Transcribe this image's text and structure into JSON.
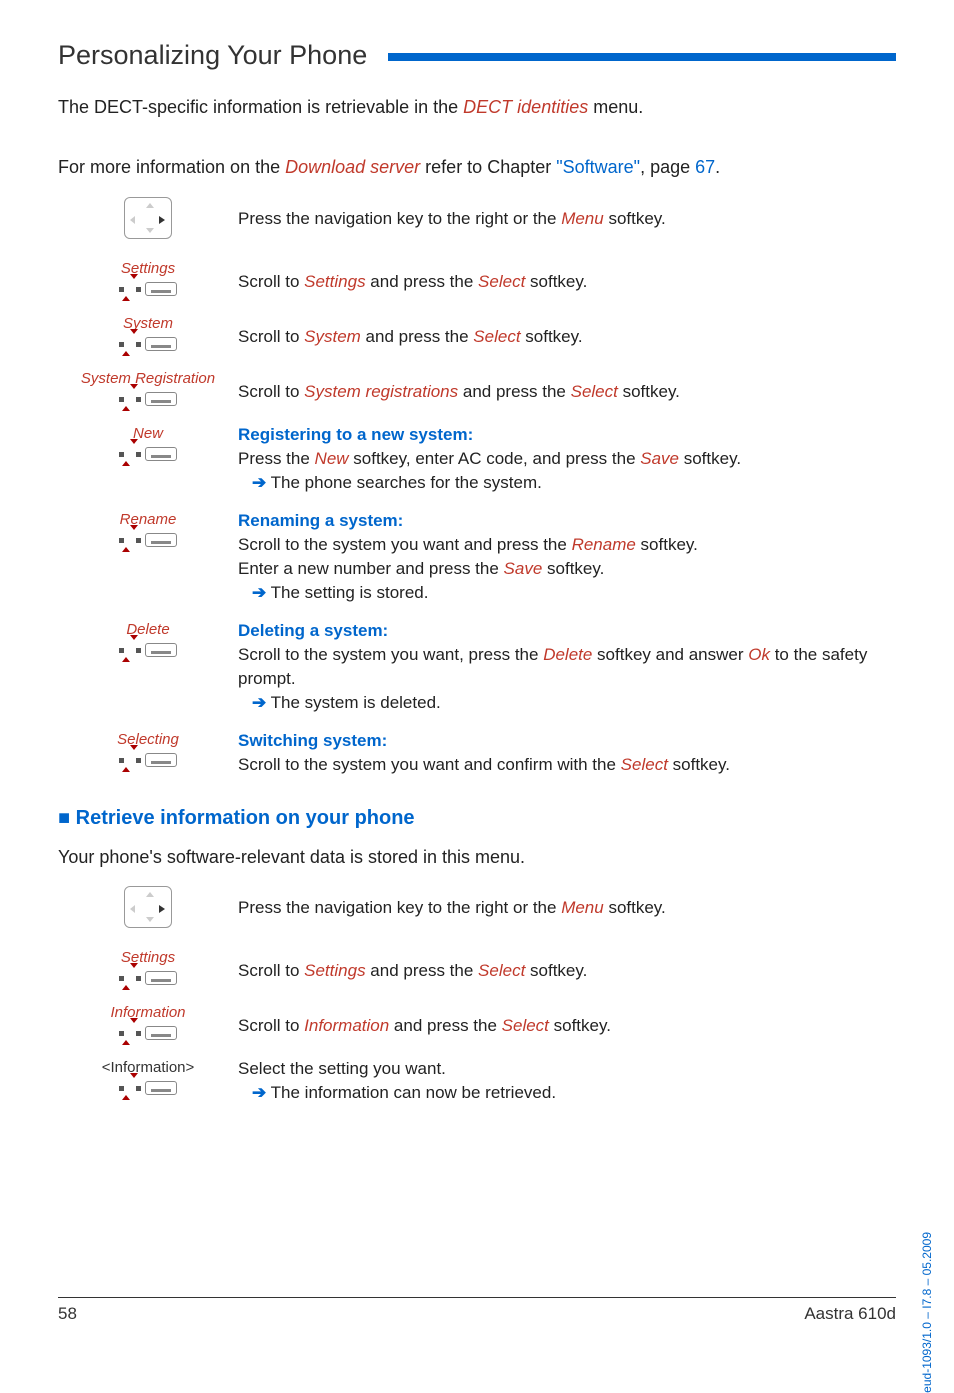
{
  "header": {
    "title": "Personalizing Your Phone"
  },
  "intro1": {
    "pre": "The DECT-specific information is retrievable in the ",
    "em": "DECT identities",
    "post": " menu."
  },
  "intro2": {
    "pre": "For more information on the ",
    "em": "Download server",
    "mid": " refer to Chapter ",
    "link1": "\"Software\"",
    "mid2": ", page ",
    "link2": "67",
    "post": "."
  },
  "steps1": {
    "navkey_text_pre": "Press the navigation key to the right or the ",
    "navkey_em": "Menu",
    "navkey_post": " softkey.",
    "settings_label": "Settings",
    "settings_pre": "Scroll to ",
    "settings_em1": "Settings",
    "settings_mid": " and press the ",
    "settings_em2": "Select",
    "settings_post": " softkey.",
    "system_label": "System",
    "system_pre": "Scroll to ",
    "system_em1": "System",
    "system_mid": " and press the ",
    "system_em2": "Select",
    "system_post": " softkey.",
    "sysreg_label": "System Registration",
    "sysreg_pre": "Scroll to ",
    "sysreg_em1": "System registrations",
    "sysreg_mid": " and press the ",
    "sysreg_em2": "Select",
    "sysreg_post": " softkey.",
    "new_label": "New",
    "new_heading": "Registering to a new system:",
    "new_line_pre": "Press the ",
    "new_em1": "New",
    "new_line_mid": " softkey, enter AC code, and press the ",
    "new_em2": "Save",
    "new_line_post": " softkey.",
    "new_result": " The phone searches for the system.",
    "rename_label": "Rename",
    "rename_heading": "Renaming a system:",
    "rename_line1_pre": "Scroll to the system you want and press the ",
    "rename_em1": "Rename",
    "rename_line1_post": " softkey.",
    "rename_line2_pre": "Enter a new number and press the ",
    "rename_em2": "Save",
    "rename_line2_post": " softkey.",
    "rename_result": " The setting is stored.",
    "delete_label": "Delete",
    "delete_heading": "Deleting a system:",
    "delete_pre": "Scroll to the system you want, press the ",
    "delete_em1": "Delete",
    "delete_mid": " softkey and answer ",
    "delete_em2": "Ok",
    "delete_post": " to the safety prompt.",
    "delete_result": " The system is deleted.",
    "selecting_label": "Selecting",
    "selecting_heading": "Switching system:",
    "selecting_pre": "Scroll to the system you want and confirm with the ",
    "selecting_em": "Select",
    "selecting_post": " softkey."
  },
  "subhead": "Retrieve information on your phone",
  "body2": "Your phone's software-relevant data is stored in this menu.",
  "steps2": {
    "navkey_text_pre": "Press the navigation key to the right or the ",
    "navkey_em": "Menu",
    "navkey_post": " softkey.",
    "settings_label": "Settings",
    "settings_pre": "Scroll to ",
    "settings_em1": "Settings",
    "settings_mid": " and press the ",
    "settings_em2": "Select",
    "settings_post": " softkey.",
    "info_label": "Information",
    "info_pre": "Scroll to ",
    "info_em1": "Information",
    "info_mid": " and press the ",
    "info_em2": "Select",
    "info_post": " softkey.",
    "infoval_label": "<Information>",
    "infoval_line": "Select the setting you want.",
    "infoval_result": " The information can now be retrieved."
  },
  "footer": {
    "page": "58",
    "product": "Aastra 610d"
  },
  "sidelabel": "eud-1093/1.0 – I7.8 – 05.2009"
}
